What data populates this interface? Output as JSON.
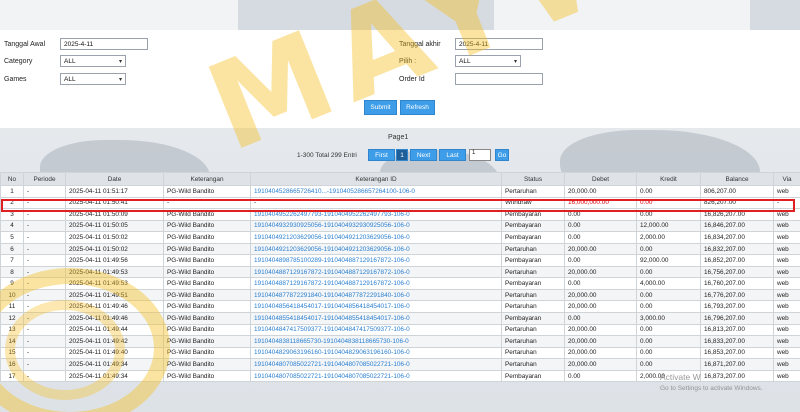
{
  "filters": {
    "start_label": "Tanggal Awal",
    "start_value": "2025-4-11",
    "end_label": "Tanggal akhir",
    "end_value": "2025-4-11",
    "category_label": "Category",
    "category_value": "ALL",
    "pilih_label": "Pilih :",
    "pilih_value": "ALL",
    "games_label": "Games",
    "games_value": "ALL",
    "order_label": "Order Id",
    "order_value": "",
    "submit_label": "Submit",
    "refresh_label": "Refresh"
  },
  "pager": {
    "page_text": "Page1",
    "total_text": "1-300 Total 299 Entri",
    "first_label": "First",
    "current_label": "1",
    "next_label": "Next",
    "last_label": "Last",
    "input_value": "1",
    "go_label": "Go"
  },
  "table": {
    "headers": [
      "No",
      "Periode",
      "Date",
      "Keterangan",
      "Keterangan ID",
      "Status",
      "Debet",
      "Kredit",
      "Balance",
      "Via"
    ],
    "rows": [
      [
        "1",
        "-",
        "2025-04-11 01:51:17",
        "PG-Wild Bandito",
        "1910404528665726410...-1910405286657264100-106-0",
        "Pertaruhan",
        "20,000.00",
        "0.00",
        "806,207.00",
        "web"
      ],
      [
        "2",
        "-",
        "2025-04-11 01:50:41",
        "-",
        "-",
        "Withdraw",
        "16,000,000.00",
        "0.00",
        "826,207.00",
        "-"
      ],
      [
        "3",
        "-",
        "2025-04-11 01:50:09",
        "PG-Wild Bandito",
        "1910404952262497793-1910404952262497793-106-0",
        "Pembayaran",
        "0.00",
        "0.00",
        "16,826,207.00",
        "web"
      ],
      [
        "4",
        "-",
        "2025-04-11 01:50:05",
        "PG-Wild Bandito",
        "1910404932930925056-1910404932930925056-106-0",
        "Pembayaran",
        "0.00",
        "12,000.00",
        "16,846,207.00",
        "web"
      ],
      [
        "5",
        "-",
        "2025-04-11 01:50:02",
        "PG-Wild Bandito",
        "1910404921203629056-1910404921203629056-106-0",
        "Pembayaran",
        "0.00",
        "2,000.00",
        "16,834,207.00",
        "web"
      ],
      [
        "6",
        "-",
        "2025-04-11 01:50:02",
        "PG-Wild Bandito",
        "1910404921203629056-1910404921203629056-106-0",
        "Pertaruhan",
        "20,000.00",
        "0.00",
        "16,832,207.00",
        "web"
      ],
      [
        "7",
        "-",
        "2025-04-11 01:49:56",
        "PG-Wild Bandito",
        "1910404898785100289-1910404887129167872-106-0",
        "Pembayaran",
        "0.00",
        "92,000.00",
        "16,852,207.00",
        "web"
      ],
      [
        "8",
        "-",
        "2025-04-11 01:49:53",
        "PG-Wild Bandito",
        "1910404887129167872-1910404887129167872-106-0",
        "Pertaruhan",
        "20,000.00",
        "0.00",
        "16,756,207.00",
        "web"
      ],
      [
        "9",
        "-",
        "2025-04-11 01:49:53",
        "PG-Wild Bandito",
        "1910404887129167872-1910404887129167872-106-0",
        "Pembayaran",
        "0.00",
        "4,000.00",
        "16,760,207.00",
        "web"
      ],
      [
        "10",
        "-",
        "2025-04-11 01:49:51",
        "PG-Wild Bandito",
        "1910404877872291840-1910404877872291840-106-0",
        "Pertaruhan",
        "20,000.00",
        "0.00",
        "16,776,207.00",
        "web"
      ],
      [
        "11",
        "-",
        "2025-04-11 01:49:46",
        "PG-Wild Bandito",
        "1910404856418454017-1910404856418454017-106-0",
        "Pertaruhan",
        "20,000.00",
        "0.00",
        "16,793,207.00",
        "web"
      ],
      [
        "12",
        "-",
        "2025-04-11 01:49:46",
        "PG-Wild Bandito",
        "1910404855418454017-1910404855418454017-106-0",
        "Pembayaran",
        "0.00",
        "3,000.00",
        "16,796,207.00",
        "web"
      ],
      [
        "13",
        "-",
        "2025-04-11 01:49:44",
        "PG-Wild Bandito",
        "1910404847417509377-1910404847417509377-106-0",
        "Pertaruhan",
        "20,000.00",
        "0.00",
        "16,813,207.00",
        "web"
      ],
      [
        "14",
        "-",
        "2025-04-11 01:49:42",
        "PG-Wild Bandito",
        "1910404838118665730-1910404838118665730-106-0",
        "Pertaruhan",
        "20,000.00",
        "0.00",
        "16,833,207.00",
        "web"
      ],
      [
        "15",
        "-",
        "2025-04-11 01:49:40",
        "PG-Wild Bandito",
        "1910404829063196160-1910404829063196160-106-0",
        "Pertaruhan",
        "20,000.00",
        "0.00",
        "16,853,207.00",
        "web"
      ],
      [
        "16",
        "-",
        "2025-04-11 01:49:34",
        "PG-Wild Bandito",
        "1910404807085022721-1910404807085022721-106-0",
        "Pertaruhan",
        "20,000.00",
        "0.00",
        "16,871,207.00",
        "web"
      ],
      [
        "17",
        "-",
        "2025-04-11 01:49:34",
        "PG-Wild Bandito",
        "1910404807085022721-1910404807085022721-106-0",
        "Pembayaran",
        "0.00",
        "2,000.00",
        "16,873,207.00",
        "web"
      ]
    ]
  },
  "watermark": "MAYWIK",
  "activate": {
    "title": "Activate W",
    "sub": "Go to Settings to activate Windows."
  },
  "colors": {
    "button_blue": "#3d9de8",
    "link_blue": "#2a7fd0",
    "highlight_red": "#e02020",
    "debit_red": "#d8000c"
  }
}
